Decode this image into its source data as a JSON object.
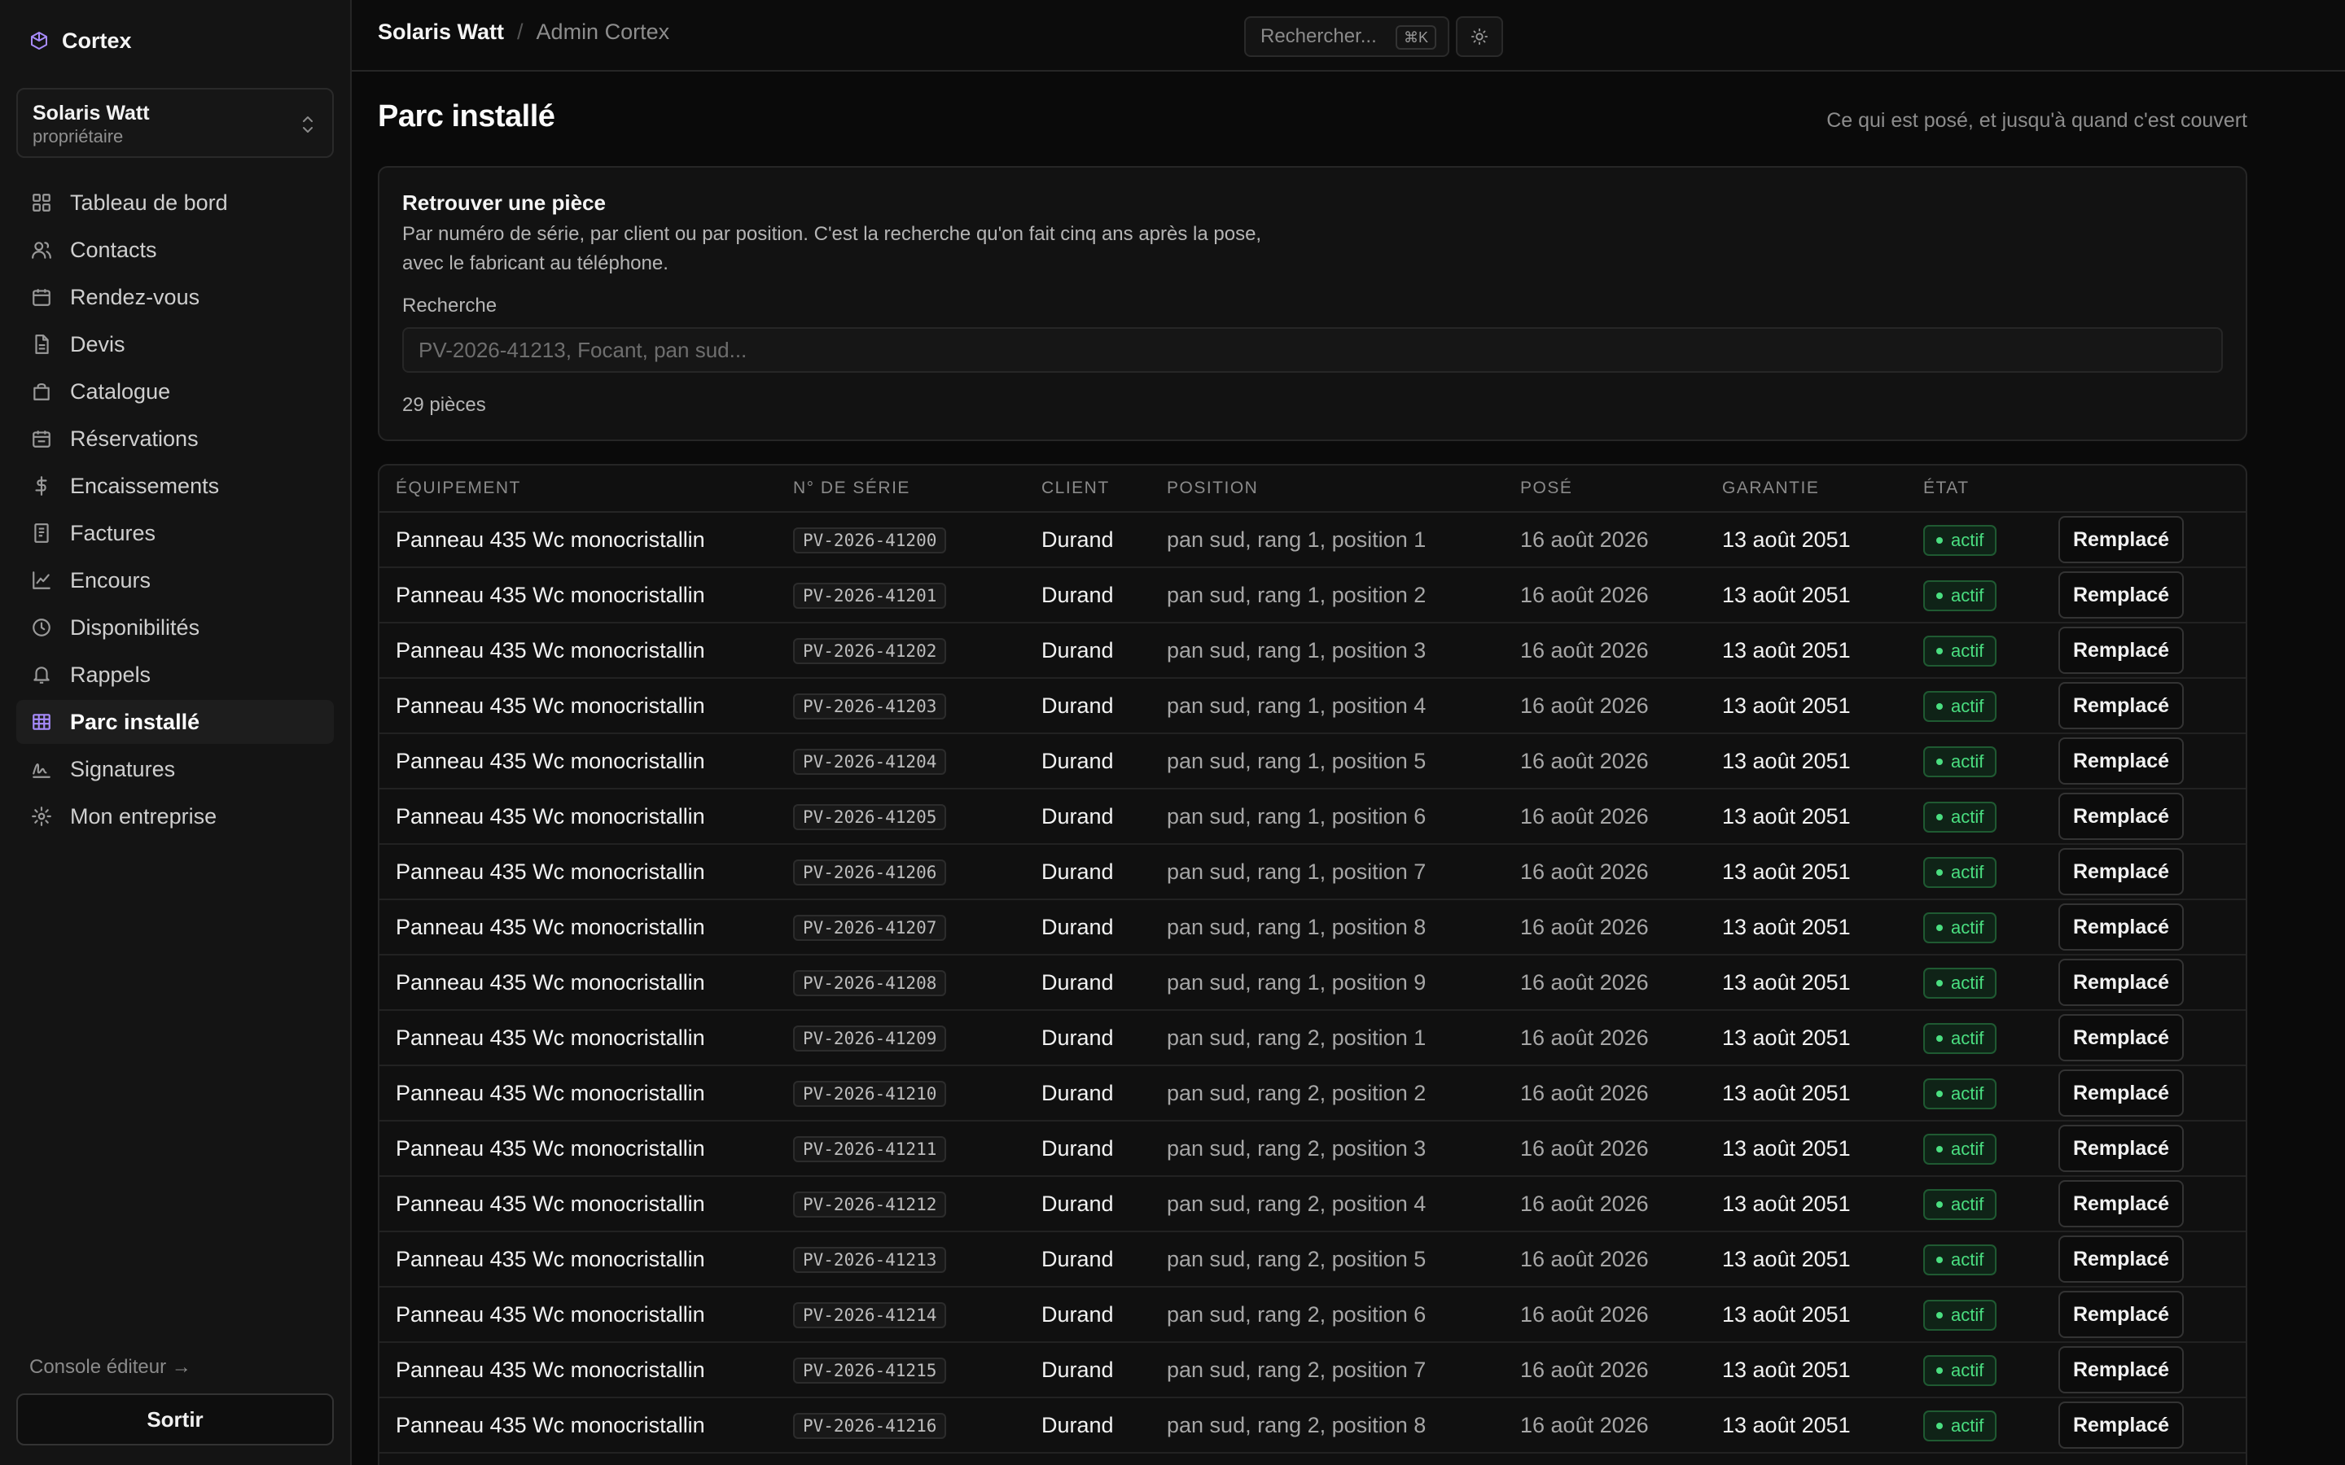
{
  "sidebar": {
    "brand": "Cortex",
    "org": {
      "name": "Solaris Watt",
      "role": "propriétaire"
    },
    "items": [
      {
        "label": "Tableau de bord",
        "icon": "dashboard-icon"
      },
      {
        "label": "Contacts",
        "icon": "users-icon"
      },
      {
        "label": "Rendez-vous",
        "icon": "calendar-icon"
      },
      {
        "label": "Devis",
        "icon": "document-icon"
      },
      {
        "label": "Catalogue",
        "icon": "bag-icon"
      },
      {
        "label": "Réservations",
        "icon": "calendar-check-icon"
      },
      {
        "label": "Encaissements",
        "icon": "dollar-icon"
      },
      {
        "label": "Factures",
        "icon": "receipt-icon"
      },
      {
        "label": "Encours",
        "icon": "trend-icon"
      },
      {
        "label": "Disponibilités",
        "icon": "clock-icon"
      },
      {
        "label": "Rappels",
        "icon": "bell-icon"
      },
      {
        "label": "Parc installé",
        "icon": "grid-icon",
        "active": true
      },
      {
        "label": "Signatures",
        "icon": "signature-icon"
      },
      {
        "label": "Mon entreprise",
        "icon": "gear-icon"
      }
    ],
    "console_link": "Console éditeur →",
    "logout_label": "Sortir"
  },
  "topbar": {
    "crumb_current": "Solaris Watt",
    "crumb_sep": "/",
    "crumb_parent": "Admin Cortex",
    "search_label": "Rechercher...",
    "search_shortcut": "⌘K"
  },
  "page": {
    "title": "Parc installé",
    "subtitle": "Ce qui est posé, et jusqu'à quand c'est couvert"
  },
  "finder": {
    "title": "Retrouver une pièce",
    "desc_line1": "Par numéro de série, par client ou par position. C'est la recherche qu'on fait cinq ans après la pose,",
    "desc_line2": "avec le fabricant au téléphone.",
    "label": "Recherche",
    "placeholder": "PV-2026-41213, Focant, pan sud...",
    "count": "29 pièces"
  },
  "table": {
    "headers": {
      "equipment": "Équipement",
      "serial": "N° de série",
      "client": "Client",
      "position": "Position",
      "installed": "Posé",
      "warranty": "Garantie",
      "state": "État"
    },
    "rows": [
      {
        "equipment": "Panneau 435 Wc monocristallin",
        "serial": "PV-2026-41200",
        "client": "Durand",
        "position": "pan sud, rang 1, position 1",
        "installed": "16 août 2026",
        "warranty": "13 août 2051",
        "state": "actif",
        "action": "Remplacé"
      },
      {
        "equipment": "Panneau 435 Wc monocristallin",
        "serial": "PV-2026-41201",
        "client": "Durand",
        "position": "pan sud, rang 1, position 2",
        "installed": "16 août 2026",
        "warranty": "13 août 2051",
        "state": "actif",
        "action": "Remplacé"
      },
      {
        "equipment": "Panneau 435 Wc monocristallin",
        "serial": "PV-2026-41202",
        "client": "Durand",
        "position": "pan sud, rang 1, position 3",
        "installed": "16 août 2026",
        "warranty": "13 août 2051",
        "state": "actif",
        "action": "Remplacé"
      },
      {
        "equipment": "Panneau 435 Wc monocristallin",
        "serial": "PV-2026-41203",
        "client": "Durand",
        "position": "pan sud, rang 1, position 4",
        "installed": "16 août 2026",
        "warranty": "13 août 2051",
        "state": "actif",
        "action": "Remplacé"
      },
      {
        "equipment": "Panneau 435 Wc monocristallin",
        "serial": "PV-2026-41204",
        "client": "Durand",
        "position": "pan sud, rang 1, position 5",
        "installed": "16 août 2026",
        "warranty": "13 août 2051",
        "state": "actif",
        "action": "Remplacé"
      },
      {
        "equipment": "Panneau 435 Wc monocristallin",
        "serial": "PV-2026-41205",
        "client": "Durand",
        "position": "pan sud, rang 1, position 6",
        "installed": "16 août 2026",
        "warranty": "13 août 2051",
        "state": "actif",
        "action": "Remplacé"
      },
      {
        "equipment": "Panneau 435 Wc monocristallin",
        "serial": "PV-2026-41206",
        "client": "Durand",
        "position": "pan sud, rang 1, position 7",
        "installed": "16 août 2026",
        "warranty": "13 août 2051",
        "state": "actif",
        "action": "Remplacé"
      },
      {
        "equipment": "Panneau 435 Wc monocristallin",
        "serial": "PV-2026-41207",
        "client": "Durand",
        "position": "pan sud, rang 1, position 8",
        "installed": "16 août 2026",
        "warranty": "13 août 2051",
        "state": "actif",
        "action": "Remplacé"
      },
      {
        "equipment": "Panneau 435 Wc monocristallin",
        "serial": "PV-2026-41208",
        "client": "Durand",
        "position": "pan sud, rang 1, position 9",
        "installed": "16 août 2026",
        "warranty": "13 août 2051",
        "state": "actif",
        "action": "Remplacé"
      },
      {
        "equipment": "Panneau 435 Wc monocristallin",
        "serial": "PV-2026-41209",
        "client": "Durand",
        "position": "pan sud, rang 2, position 1",
        "installed": "16 août 2026",
        "warranty": "13 août 2051",
        "state": "actif",
        "action": "Remplacé"
      },
      {
        "equipment": "Panneau 435 Wc monocristallin",
        "serial": "PV-2026-41210",
        "client": "Durand",
        "position": "pan sud, rang 2, position 2",
        "installed": "16 août 2026",
        "warranty": "13 août 2051",
        "state": "actif",
        "action": "Remplacé"
      },
      {
        "equipment": "Panneau 435 Wc monocristallin",
        "serial": "PV-2026-41211",
        "client": "Durand",
        "position": "pan sud, rang 2, position 3",
        "installed": "16 août 2026",
        "warranty": "13 août 2051",
        "state": "actif",
        "action": "Remplacé"
      },
      {
        "equipment": "Panneau 435 Wc monocristallin",
        "serial": "PV-2026-41212",
        "client": "Durand",
        "position": "pan sud, rang 2, position 4",
        "installed": "16 août 2026",
        "warranty": "13 août 2051",
        "state": "actif",
        "action": "Remplacé"
      },
      {
        "equipment": "Panneau 435 Wc monocristallin",
        "serial": "PV-2026-41213",
        "client": "Durand",
        "position": "pan sud, rang 2, position 5",
        "installed": "16 août 2026",
        "warranty": "13 août 2051",
        "state": "actif",
        "action": "Remplacé"
      },
      {
        "equipment": "Panneau 435 Wc monocristallin",
        "serial": "PV-2026-41214",
        "client": "Durand",
        "position": "pan sud, rang 2, position 6",
        "installed": "16 août 2026",
        "warranty": "13 août 2051",
        "state": "actif",
        "action": "Remplacé"
      },
      {
        "equipment": "Panneau 435 Wc monocristallin",
        "serial": "PV-2026-41215",
        "client": "Durand",
        "position": "pan sud, rang 2, position 7",
        "installed": "16 août 2026",
        "warranty": "13 août 2051",
        "state": "actif",
        "action": "Remplacé"
      },
      {
        "equipment": "Panneau 435 Wc monocristallin",
        "serial": "PV-2026-41216",
        "client": "Durand",
        "position": "pan sud, rang 2, position 8",
        "installed": "16 août 2026",
        "warranty": "13 août 2051",
        "state": "actif",
        "action": "Remplacé"
      }
    ]
  },
  "colors": {
    "accent": "#a78bfa",
    "status_active": "#4ade80",
    "background": "#0a0a0a"
  }
}
